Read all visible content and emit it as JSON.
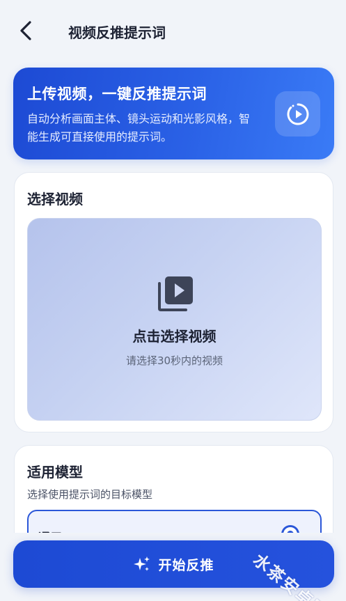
{
  "header": {
    "title": "视频反推提示词",
    "back_icon": "chevron-left-icon"
  },
  "hero": {
    "title": "上传视频，一键反推提示词",
    "description": "自动分析画面主体、镜头运动和光影风格，智能生成可直接使用的提示词。",
    "icon": "play-circle-icon"
  },
  "select_video": {
    "title": "选择视频",
    "drop_title": "点击选择视频",
    "drop_hint": "请选择30秒内的视频",
    "icon": "video-library-icon"
  },
  "model": {
    "title": "适用模型",
    "subtitle": "选择使用提示词的目标模型",
    "options": [
      {
        "label": "通用",
        "selected": true
      }
    ]
  },
  "cta": {
    "label": "开始反推",
    "icon": "sparkle-icon"
  },
  "watermark": "水茶安卓网",
  "colors": {
    "primary": "#2552dd",
    "background": "#f1f4f9",
    "text": "#1d2233"
  }
}
